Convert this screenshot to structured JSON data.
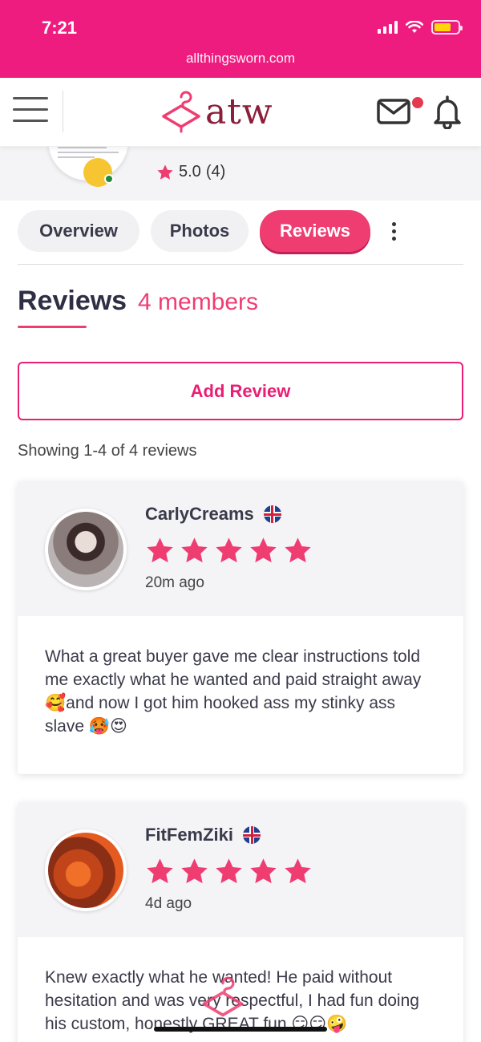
{
  "status_bar": {
    "time": "7:21",
    "url": "allthingsworn.com"
  },
  "header": {
    "logo_text": "atw"
  },
  "profile": {
    "rating": "5.0",
    "rating_count": "(4)"
  },
  "tabs": [
    {
      "label": "Overview",
      "active": false
    },
    {
      "label": "Photos",
      "active": false
    },
    {
      "label": "Reviews",
      "active": true
    }
  ],
  "section": {
    "title": "Reviews",
    "count": "4 members",
    "add_button": "Add Review",
    "showing": "Showing 1-4 of 4 reviews"
  },
  "reviews": [
    {
      "name": "CarlyCreams",
      "stars": 5,
      "time": "20m ago",
      "text": "What a great buyer gave me clear instructions told me exactly what he wanted and paid straight away 🥰and now I got him hooked ass my stinky ass slave 🥵😍"
    },
    {
      "name": "FitFemZiki",
      "stars": 5,
      "time": "4d ago",
      "text": "Knew exactly what he wanted! He paid without hesitation and was very respectful, I had fun doing his custom, honestly GREAT fun 😏😏🤪"
    }
  ],
  "colors": {
    "brand_pink": "#ee1c7f",
    "accent": "#ef3d71",
    "logo": "#8b1e3a"
  }
}
